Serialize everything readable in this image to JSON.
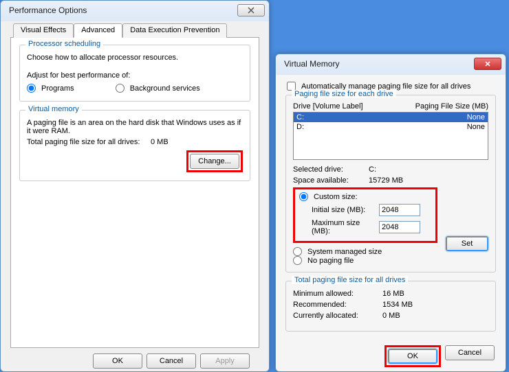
{
  "perf": {
    "title": "Performance Options",
    "tabs": {
      "visual": "Visual Effects",
      "advanced": "Advanced",
      "dep": "Data Execution Prevention"
    },
    "proc": {
      "group": "Processor scheduling",
      "desc": "Choose how to allocate processor resources.",
      "adjust": "Adjust for best performance of:",
      "programs": "Programs",
      "bgservices": "Background services"
    },
    "vm": {
      "group": "Virtual memory",
      "desc": "A paging file is an area on the hard disk that Windows uses as if it were RAM.",
      "total_label": "Total paging file size for all drives:",
      "total_value": "0 MB",
      "change": "Change..."
    },
    "buttons": {
      "ok": "OK",
      "cancel": "Cancel",
      "apply": "Apply"
    }
  },
  "vmw": {
    "title": "Virtual Memory",
    "auto": "Automatically manage paging file size for all drives",
    "group_each": "Paging file size for each drive",
    "hdr_drive": "Drive  [Volume Label]",
    "hdr_size": "Paging File Size (MB)",
    "rows": [
      {
        "drive": "C:",
        "size": "None"
      },
      {
        "drive": "D:",
        "size": "None"
      }
    ],
    "selected_label": "Selected drive:",
    "selected_value": "C:",
    "space_label": "Space available:",
    "space_value": "15729 MB",
    "custom": "Custom size:",
    "init_label": "Initial size (MB):",
    "init_value": "2048",
    "max_label": "Maximum size (MB):",
    "max_value": "2048",
    "sysman": "System managed size",
    "nopf": "No paging file",
    "set": "Set",
    "group_total": "Total paging file size for all drives",
    "min_label": "Minimum allowed:",
    "min_value": "16 MB",
    "rec_label": "Recommended:",
    "rec_value": "1534 MB",
    "cur_label": "Currently allocated:",
    "cur_value": "0 MB",
    "ok": "OK",
    "cancel": "Cancel"
  }
}
